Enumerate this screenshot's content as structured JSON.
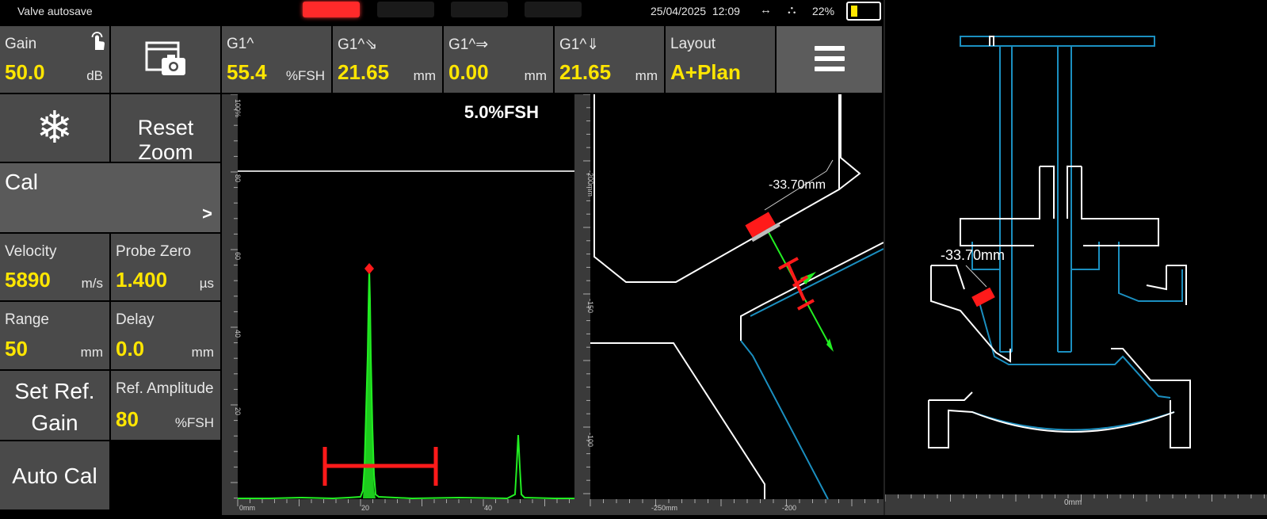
{
  "status_bar": {
    "title": "Valve autosave",
    "date": "25/04/2025",
    "time": "12:09",
    "link_icon": "↔",
    "network_icon": "⛬",
    "battery_percent": "22%",
    "battery_level": 0.22,
    "alarm_colors": [
      "#ff2a2a",
      "#1a1a1a",
      "#1a1a1a",
      "#1a1a1a"
    ]
  },
  "top_bar": {
    "gain": {
      "label": "Gain",
      "value": "50.0",
      "unit": "dB",
      "icon": "touch-icon"
    },
    "screenshot": {
      "icon": "screenshot-icon"
    },
    "readings": [
      {
        "label": "G1^",
        "value": "55.4",
        "unit": "%FSH"
      },
      {
        "label": "G1^⇘",
        "value": "21.65",
        "unit": "mm"
      },
      {
        "label": "G1^⇒",
        "value": "0.00",
        "unit": "mm"
      },
      {
        "label": "G1^⇓",
        "value": "21.65",
        "unit": "mm"
      }
    ],
    "layout": {
      "label": "Layout",
      "value": "A+Plan"
    },
    "menu": {
      "icon": "hamburger-menu-icon"
    }
  },
  "side_panel": {
    "freeze": {
      "icon": "snowflake-icon",
      "glyph": "❄"
    },
    "reset_zoom": "Reset Zoom",
    "cal": {
      "label": "Cal",
      "arrow": ">"
    },
    "velocity": {
      "label": "Velocity",
      "value": "5890",
      "unit": "m/s"
    },
    "probe_zero": {
      "label": "Probe Zero",
      "value": "1.400",
      "unit": "µs"
    },
    "range": {
      "label": "Range",
      "value": "50",
      "unit": "mm"
    },
    "delay": {
      "label": "Delay",
      "value": "0.0",
      "unit": "mm"
    },
    "set_ref_gain": {
      "line1": "Set Ref.",
      "line2": "Gain"
    },
    "ref_amplitude": {
      "label": "Ref. Amplitude",
      "value": "80",
      "unit": "%FSH"
    },
    "auto_cal": "Auto Cal"
  },
  "ascan": {
    "gate_level_label": "5.0%FSH",
    "y_tick_labels": [
      "100%",
      "80",
      "60",
      "40",
      "20"
    ],
    "x_tick_labels": [
      "0mm",
      "20",
      "40"
    ],
    "peak_percent_fsh": 55.4,
    "colors": {
      "signal": "#22ee22",
      "gate": "#ff1a1a",
      "threshold": "#cccccc"
    }
  },
  "plan_view": {
    "measurement_label": "-33.70mm",
    "y_tick_labels": [
      "-200mm",
      "-150",
      "-100"
    ],
    "x_tick_labels": [
      "-250mm",
      "-200"
    ],
    "colors": {
      "part": "#ffffff",
      "back_wall": "#1b8fc0",
      "beam": "#22ee22",
      "probe": "#ff1a1a"
    }
  },
  "overview": {
    "measurement_label": "-33.70mm",
    "x_tick_labels": [
      "0mm"
    ],
    "colors": {
      "outer": "#ffffff",
      "inner": "#1b8fc0"
    }
  }
}
